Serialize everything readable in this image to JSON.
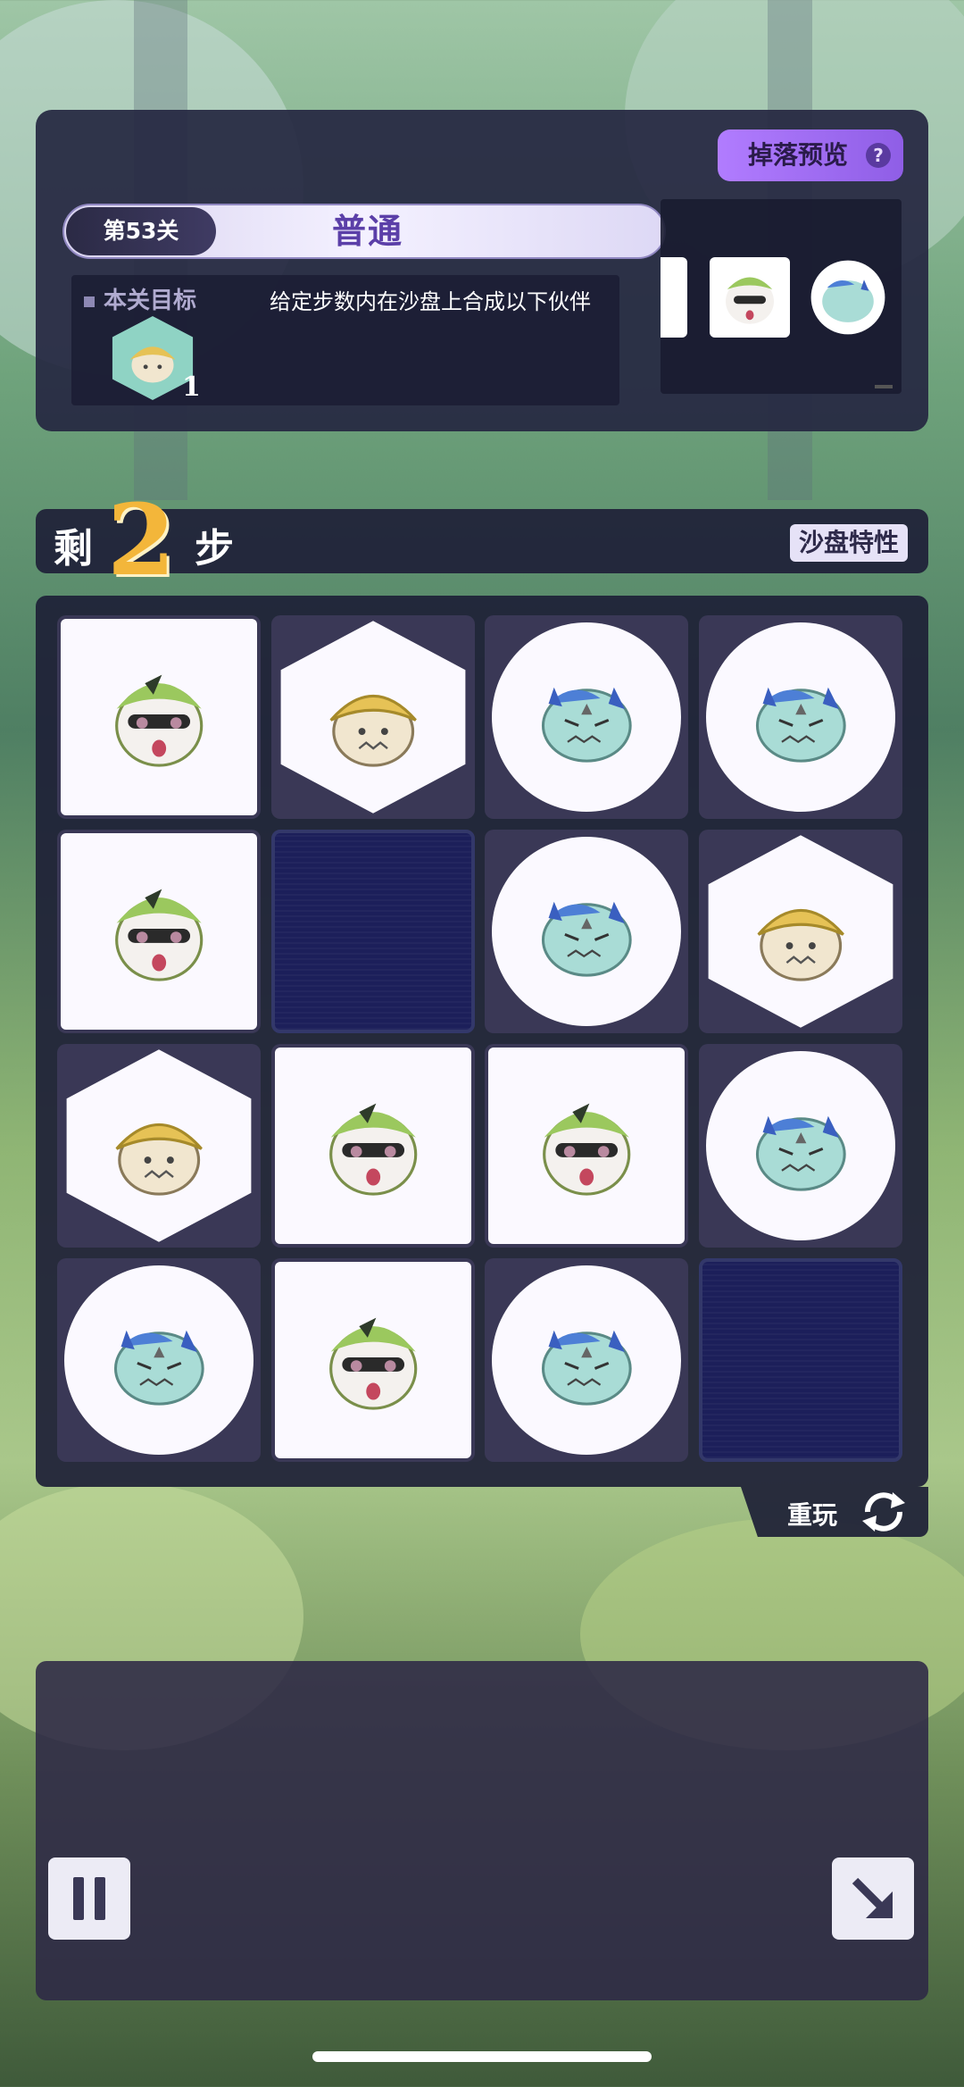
{
  "drop_preview": {
    "label": "掉落预览",
    "help_icon": "?"
  },
  "level": {
    "badge": "第53关",
    "mode": "普通"
  },
  "goal": {
    "title": "本关目标",
    "description": "给定步数内在沙盘上合成以下伙伴",
    "count": "1"
  },
  "steps": {
    "prefix": "剩",
    "number": "2",
    "suffix": "步",
    "sand_button": "沙盘特性"
  },
  "board": {
    "rows": [
      [
        "frog",
        "hat",
        "dragon",
        "dragon"
      ],
      [
        "frog",
        "empty",
        "dragon",
        "hat"
      ],
      [
        "hat",
        "frog",
        "frog",
        "dragon"
      ],
      [
        "dragon",
        "frog",
        "dragon",
        "empty"
      ]
    ]
  },
  "replay": {
    "label": "重玩"
  },
  "colors": {
    "accent": "#8f5ee6",
    "steps_number": "#f3b63a",
    "panel": "#262842"
  }
}
